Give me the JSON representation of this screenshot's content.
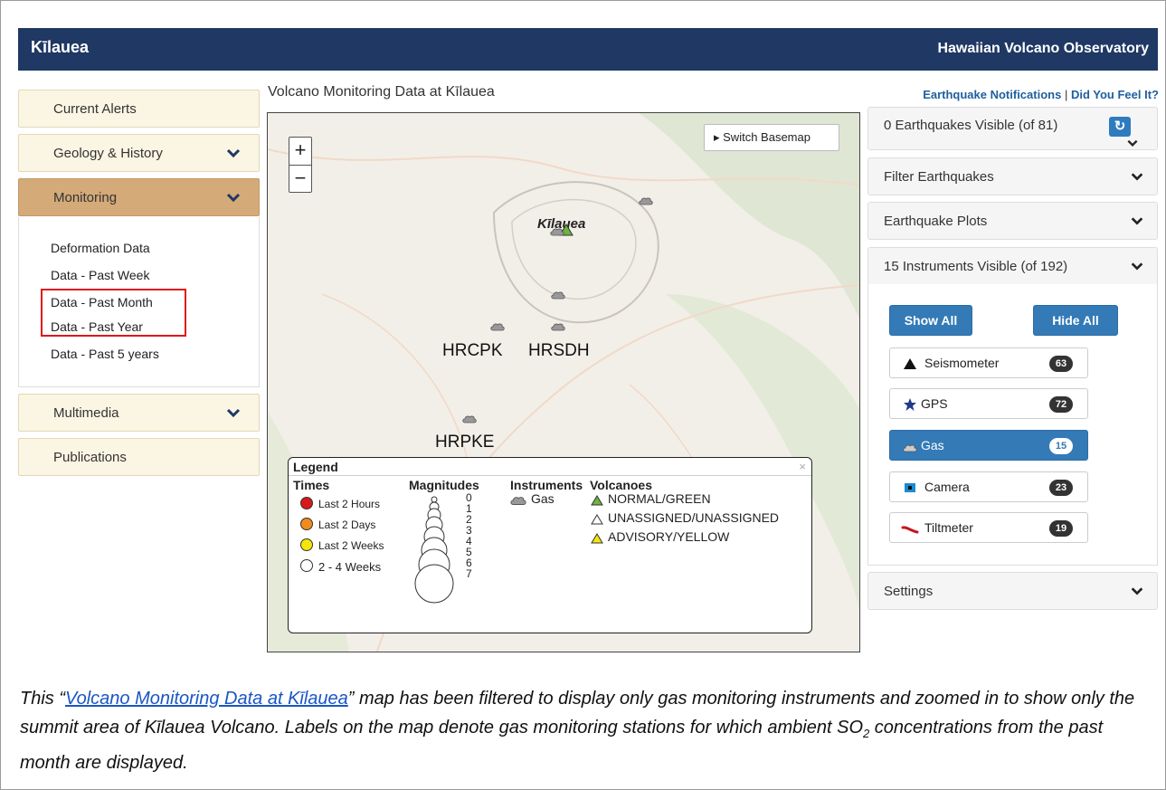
{
  "header": {
    "title": "Kīlauea",
    "org": "Hawaiian Volcano Observatory"
  },
  "sidebar": {
    "items": [
      {
        "label": "Current Alerts"
      },
      {
        "label": "Geology & History"
      },
      {
        "label": "Monitoring"
      },
      {
        "label": "Multimedia"
      },
      {
        "label": "Publications"
      }
    ],
    "monitoring_links": [
      "Deformation Data",
      "Data - Past Week",
      "Data - Past Month",
      "Data - Past Year",
      "Data - Past 5 years"
    ]
  },
  "map": {
    "title": "Volcano Monitoring Data at Kīlauea",
    "zoom_in": "+",
    "zoom_out": "−",
    "switch_basemap": "▸ Switch Basemap",
    "volcano_label": "Kīlauea",
    "stations": [
      "HRCPK",
      "HRSDH",
      "HRPKE"
    ],
    "legend": {
      "title": "Legend",
      "close": "×",
      "times_header": "Times",
      "times": [
        "Last 2 Hours",
        "Last 2 Days",
        "Last 2 Weeks",
        "2 - 4 Weeks"
      ],
      "time_colors": [
        "#d7191c",
        "#f08c1e",
        "#f5e50a",
        "#ffffff"
      ],
      "magnitudes_header": "Magnitudes",
      "magnitudes": [
        "0",
        "1",
        "2",
        "3",
        "4",
        "5",
        "6",
        "7"
      ],
      "instruments_header": "Instruments",
      "instruments": [
        "Gas"
      ],
      "volcanoes_header": "Volcanoes",
      "volcanoes": [
        "NORMAL/GREEN",
        "UNASSIGNED/UNASSIGNED",
        "ADVISORY/YELLOW"
      ]
    }
  },
  "right_panel": {
    "links": {
      "notifications": "Earthquake Notifications",
      "separator": "|",
      "feel": "Did You Feel It?"
    },
    "earthquakes_visible": "0 Earthquakes Visible (of 81)",
    "refresh_icon": "↻",
    "filter": "Filter Earthquakes",
    "plots": "Earthquake Plots",
    "instruments_visible": "15 Instruments Visible (of 192)",
    "show_all": "Show All",
    "hide_all": "Hide All",
    "instruments": [
      {
        "label": "Seismometer",
        "count": "63",
        "icon": "triangle-icon"
      },
      {
        "label": "GPS",
        "count": "72",
        "icon": "star-icon"
      },
      {
        "label": "Gas",
        "count": "15",
        "icon": "cloud-icon"
      },
      {
        "label": "Camera",
        "count": "23",
        "icon": "camera-icon"
      },
      {
        "label": "Tiltmeter",
        "count": "19",
        "icon": "tiltmeter-icon"
      }
    ],
    "settings": "Settings"
  },
  "caption": {
    "open_quote": "This “",
    "link": "Volcano Monitoring Data at Kīlauea",
    "text": "” map has been filtered to display only gas monitoring instruments and zoomed in to show only the summit area of Kīlauea Volcano. Labels on the map denote gas monitoring stations for which ambient SO",
    "subscript": "2",
    "text_end": " concentrations from the past month are displayed."
  },
  "colors": {
    "header_bg": "#1f3864",
    "active_tab": "#d4aa78",
    "primary_button": "#337ab7",
    "highlight_box": "#e0161b"
  }
}
